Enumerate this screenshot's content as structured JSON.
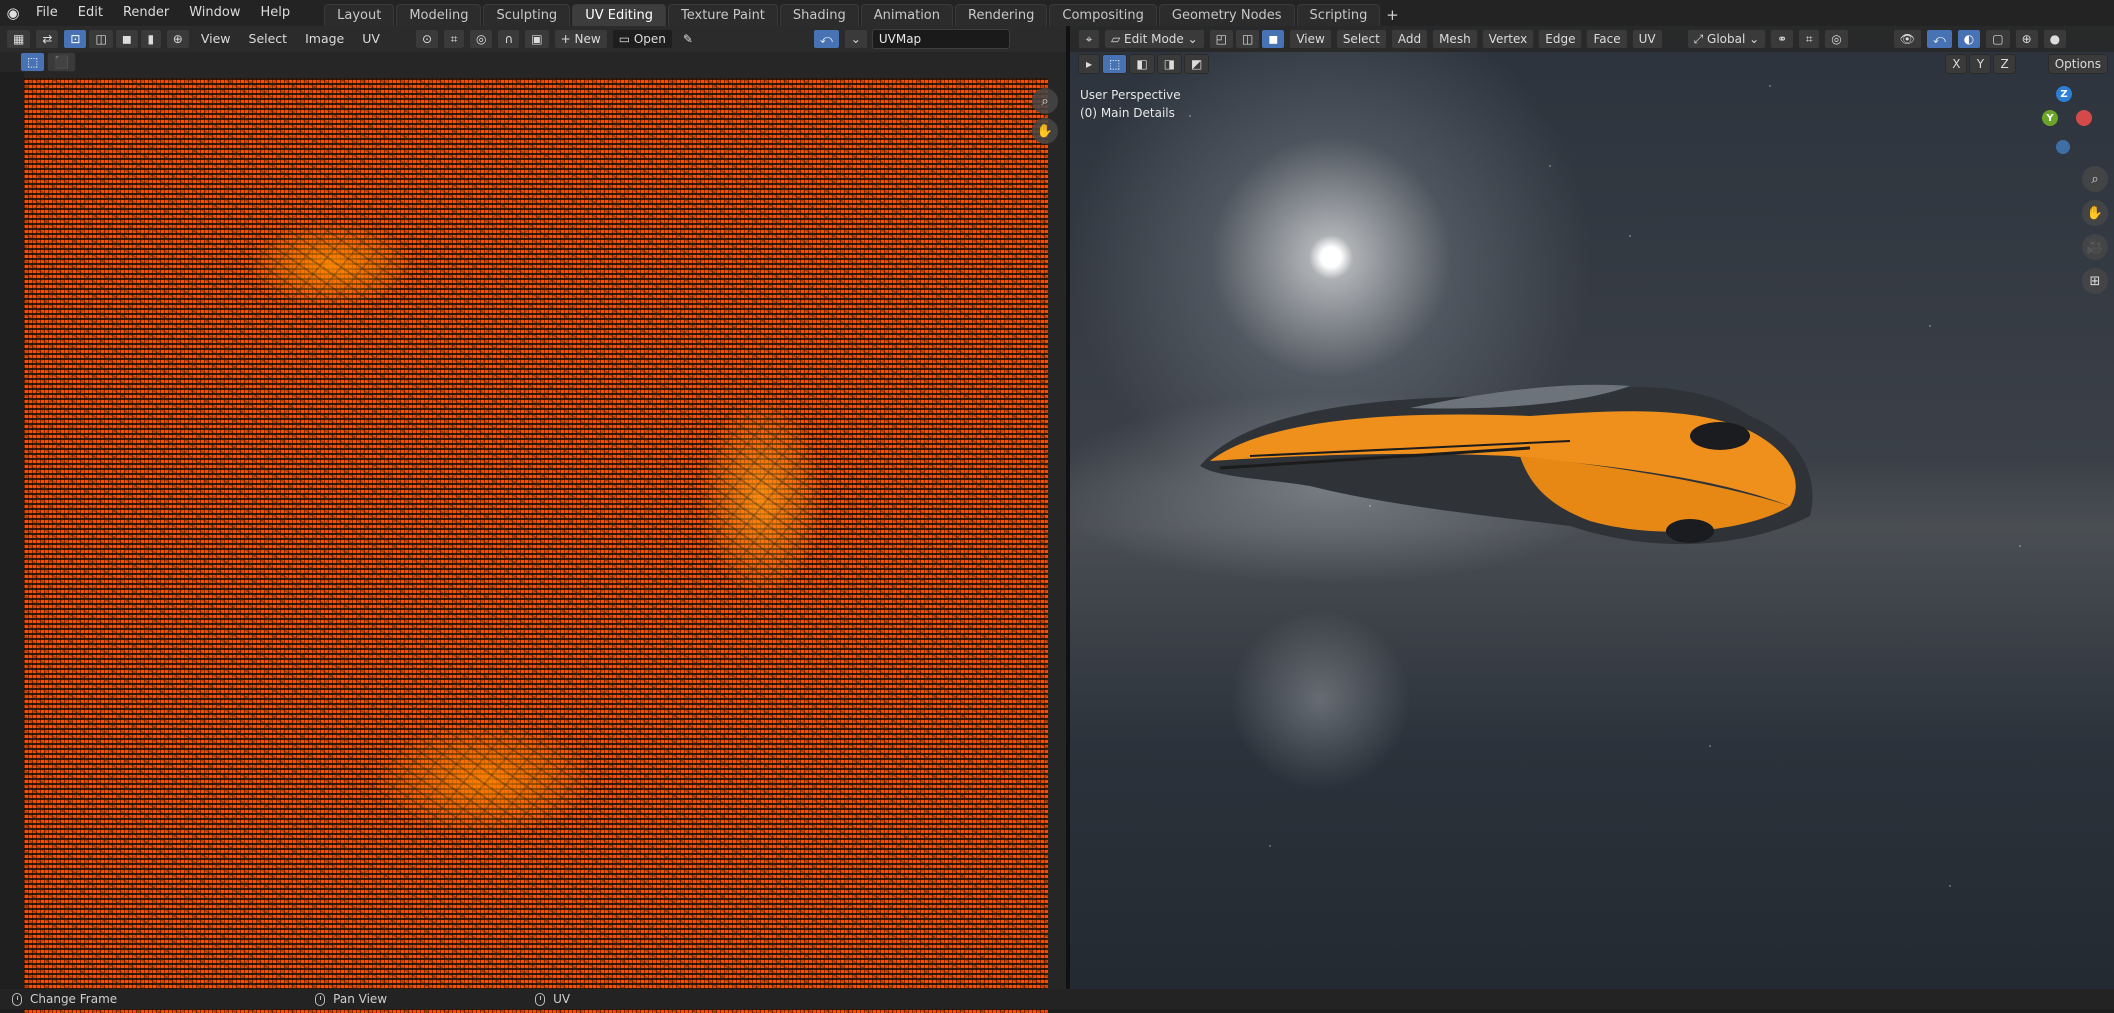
{
  "topbar": {
    "menus": [
      "File",
      "Edit",
      "Render",
      "Window",
      "Help"
    ],
    "workspaces": [
      "Layout",
      "Modeling",
      "Sculpting",
      "UV Editing",
      "Texture Paint",
      "Shading",
      "Animation",
      "Rendering",
      "Compositing",
      "Geometry Nodes",
      "Scripting"
    ],
    "active_workspace": "UV Editing",
    "add_label": "+"
  },
  "uv_editor": {
    "menus": [
      "View",
      "Select",
      "Image",
      "UV"
    ],
    "new_label": "New",
    "open_label": "Open",
    "uvmap_name": "UVMap",
    "accent": "#ff8a10"
  },
  "viewport": {
    "mode_label": "Edit Mode",
    "menus": [
      "View",
      "Select",
      "Add",
      "Mesh",
      "Vertex",
      "Edge",
      "Face",
      "UV"
    ],
    "orientation": "Global",
    "axes": [
      "X",
      "Y",
      "Z"
    ],
    "options_label": "Options",
    "perspective_label": "User Perspective",
    "object_label": "(0) Main Details",
    "gizmo": {
      "z": "Z",
      "y": "Y"
    }
  },
  "statusbar": {
    "items": [
      "Change Frame",
      "Pan View",
      "UV"
    ]
  }
}
